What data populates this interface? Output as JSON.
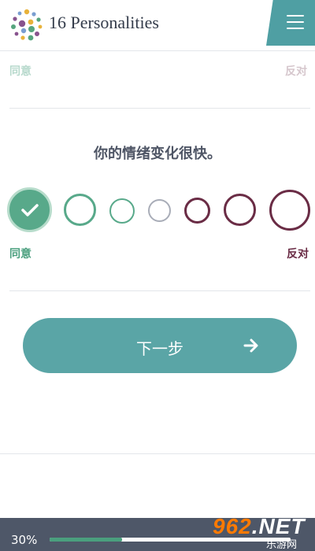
{
  "header": {
    "logo_text": "16 Personalities",
    "menu_icon": "hamburger-menu-icon"
  },
  "previous_question": {
    "agree_label": "同意",
    "disagree_label": "反对"
  },
  "question": {
    "text": "你的情绪变化很快。",
    "agree_label": "同意",
    "disagree_label": "反对",
    "selected_index": 0,
    "option_count": 7
  },
  "next_button": {
    "label": "下一步",
    "icon": "arrow-right-icon"
  },
  "progress": {
    "text": "30%",
    "value": 0.3
  },
  "watermark": {
    "main": "962",
    "suffix": ".NET",
    "sub": "乐游网"
  },
  "colors": {
    "agree": "#4a9f7e",
    "disagree": "#6a2c45",
    "neutral": "#a9adb8",
    "accent": "#5aa5a6",
    "progress_bg": "#4e5768"
  }
}
